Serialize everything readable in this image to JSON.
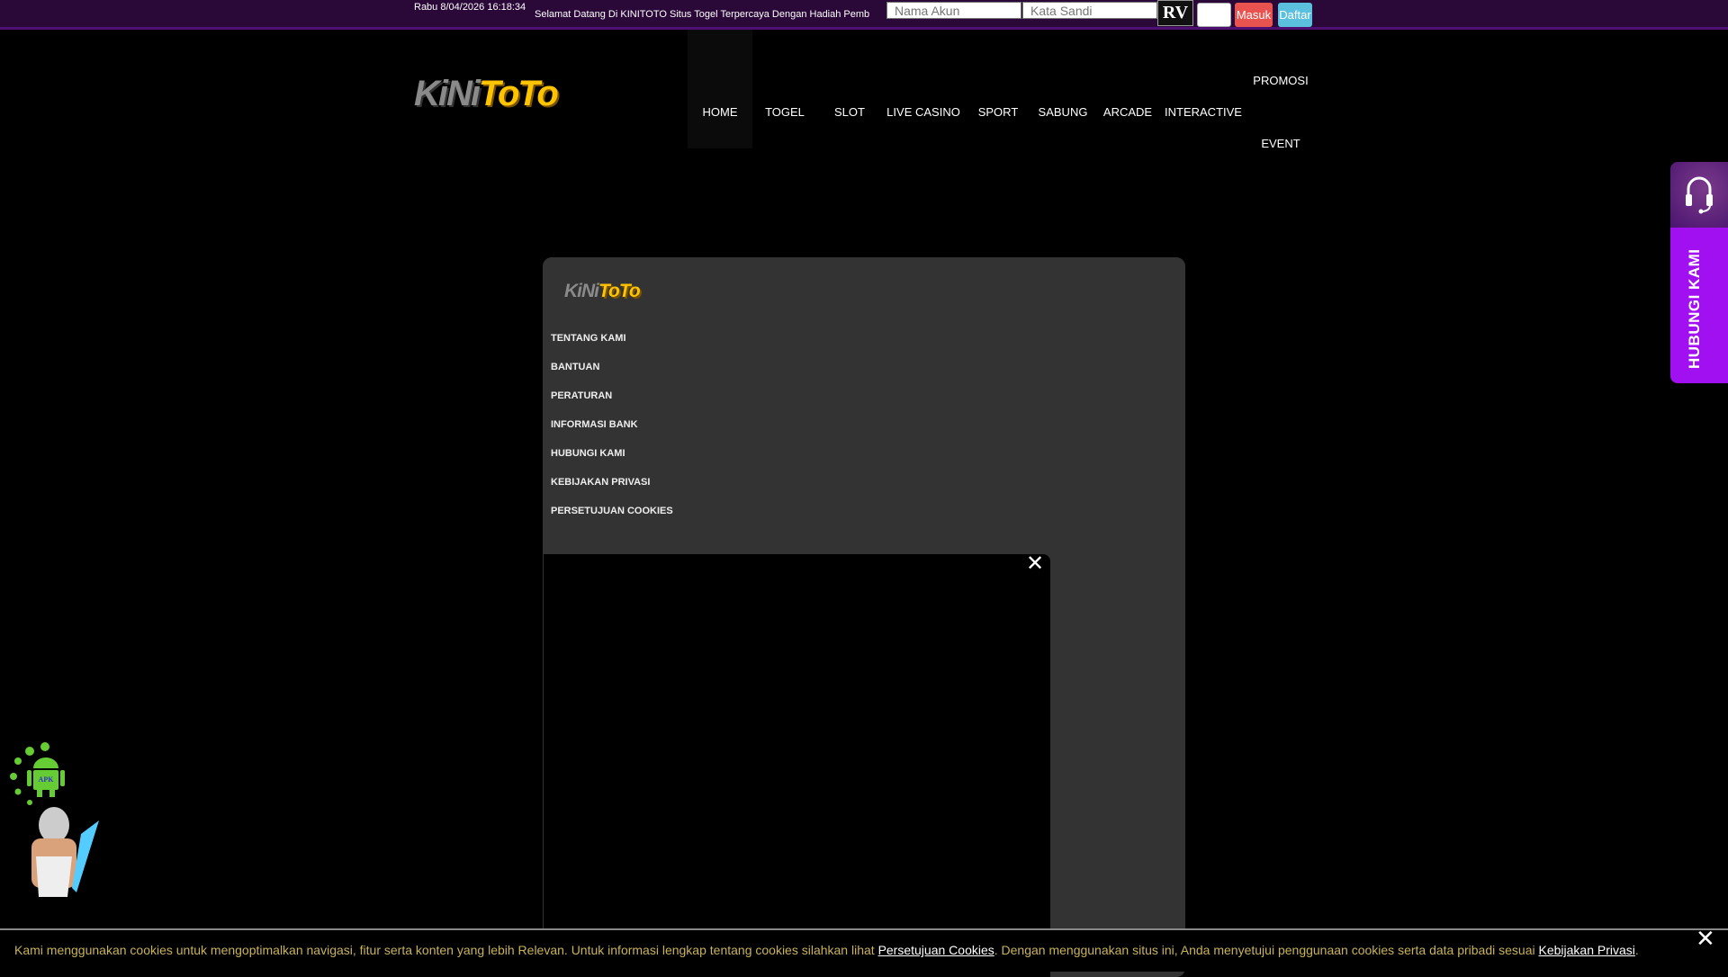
{
  "topbar": {
    "datetime": "Rabu 8/04/2026 16:18:34",
    "datetime_icon": "",
    "welcome": "Selamat Datang Di KINITOTO Situs Togel Terpercaya Dengan Hadiah Pemb",
    "username_placeholder": "Nama Akun",
    "password_placeholder": "Kata Sandi",
    "captcha_text": "RV",
    "login_label": "Masuk",
    "register_label": "Daftar",
    "login_color": "#e9534f",
    "register_color": "#5bc0de"
  },
  "logo": {
    "part1": "KiNi",
    "part2": "ToTo"
  },
  "nav": {
    "items": [
      "HOME",
      "TOGEL",
      "SLOT",
      "LIVE CASINO",
      "SPORT",
      "SABUNG",
      "ARCADE",
      "INTERACTIVE"
    ],
    "promosi": "PROMOSI",
    "event": "EVENT"
  },
  "footer": {
    "links": [
      "TENTANG KAMI",
      "BANTUAN",
      "PERATURAN",
      "INFORMASI BANK",
      "HUBUNGI KAMI",
      "KEBIJAKAN PRIVASI",
      "PERSETUJUAN COOKIES"
    ]
  },
  "contact_widget": {
    "label": "HUBUNGI KAMI"
  },
  "apk": {
    "label": "APK"
  },
  "cookie": {
    "text1": "Kami menggunakan cookies untuk mengoptimalkan navigasi, fitur serta konten yang lebih Relevan. Untuk informasi lengkap tentang cookies silahkan lihat ",
    "link1": "Persetujuan Cookies",
    "text2": ". Dengan menggunakan situs ini, Anda menyetujui penggunaan cookies serta data pribadi sesuai ",
    "link2": "Kebijakan Privasi",
    "text3": "."
  }
}
